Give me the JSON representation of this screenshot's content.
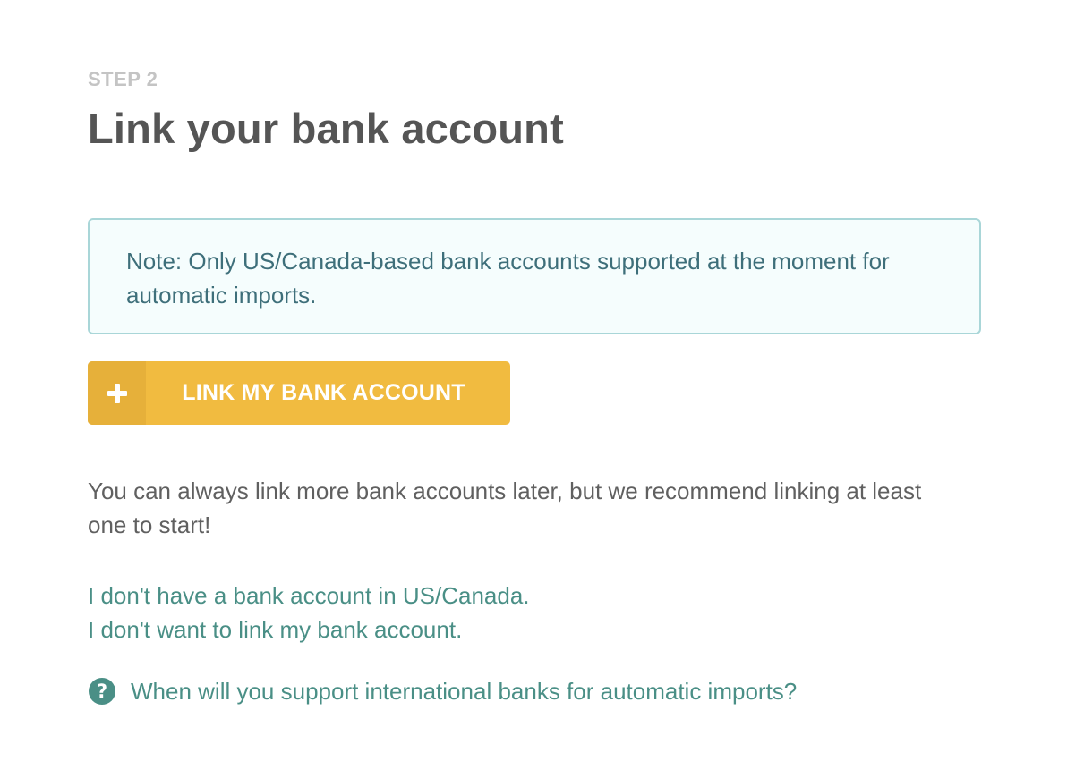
{
  "header": {
    "step_label": "STEP 2",
    "title": "Link your bank account"
  },
  "note": {
    "text": "Note: Only US/Canada-based bank accounts supported at the moment for automatic imports."
  },
  "primary_button": {
    "icon": "plus-icon",
    "label": "LINK MY BANK ACCOUNT"
  },
  "info": {
    "text": "You can always link more bank accounts later, but we recommend linking at least one to start!"
  },
  "alternatives": {
    "no_us_bank": "I don't have a bank account in US/Canada.",
    "no_link": "I don't want to link my bank account."
  },
  "faq": {
    "icon": "question-circle-icon",
    "question_mark": "?",
    "text": "When will you support international banks for automatic imports?"
  },
  "colors": {
    "accent_yellow": "#f1bb40",
    "accent_yellow_dark": "#e6b03a",
    "link_teal": "#4a8f86",
    "note_border": "#a9d6d8",
    "note_background": "#f5fdfd",
    "note_text": "#3e6f7a",
    "title_text": "#555555",
    "step_text": "#c4c4c4"
  }
}
